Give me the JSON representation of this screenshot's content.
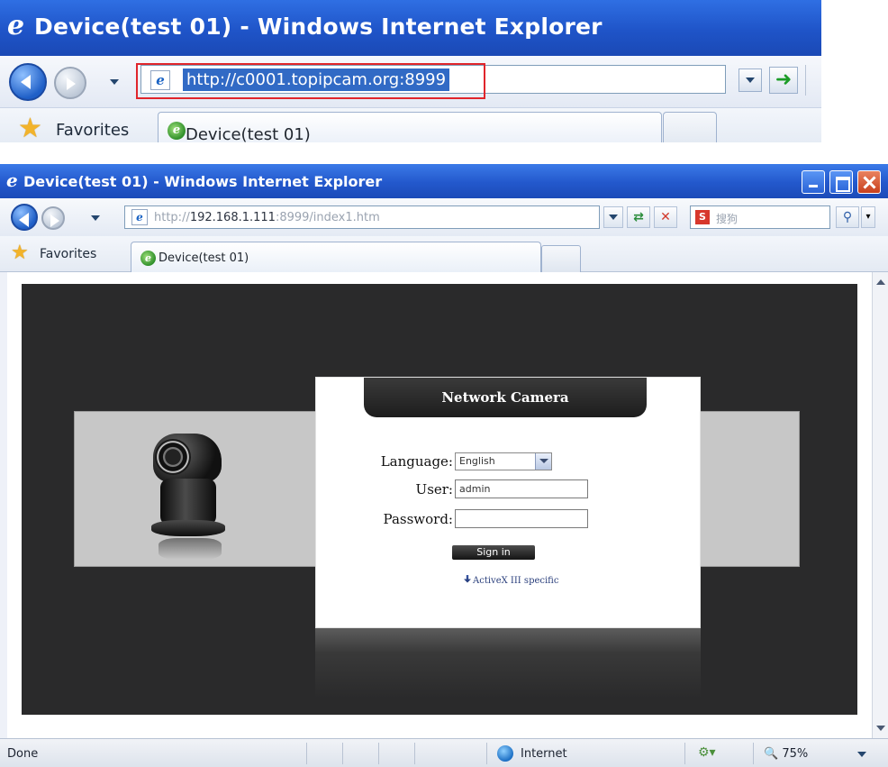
{
  "snippet": {
    "window_title": "Device(test 01) - Windows Internet Explorer",
    "address_url": "http://c0001.topipcam.org:8999",
    "favorites_label": "Favorites",
    "tab_title": "Device(test 01)",
    "highlight_color": "#e0252b"
  },
  "window": {
    "title": "Device(test 01) - Windows Internet Explorer",
    "address": {
      "prefix": "http://",
      "host": "192.168.1.111",
      "suffix": ":8999/index1.htm"
    },
    "search_placeholder": "搜狗",
    "favorites_label": "Favorites",
    "tab_title": "Device(test 01)",
    "title_gradient": [
      "#3b7ae8",
      "#1c4bb8"
    ]
  },
  "login": {
    "header": "Network Camera",
    "language_label": "Language:",
    "language_value": "English",
    "user_label": "User:",
    "user_value": "admin",
    "password_label": "Password:",
    "password_value": "",
    "signin_label": "Sign in",
    "activex_link": "ActiveX III specific"
  },
  "status_bar": {
    "left_text": "Done",
    "zone": "Internet",
    "zoom": "75%"
  }
}
